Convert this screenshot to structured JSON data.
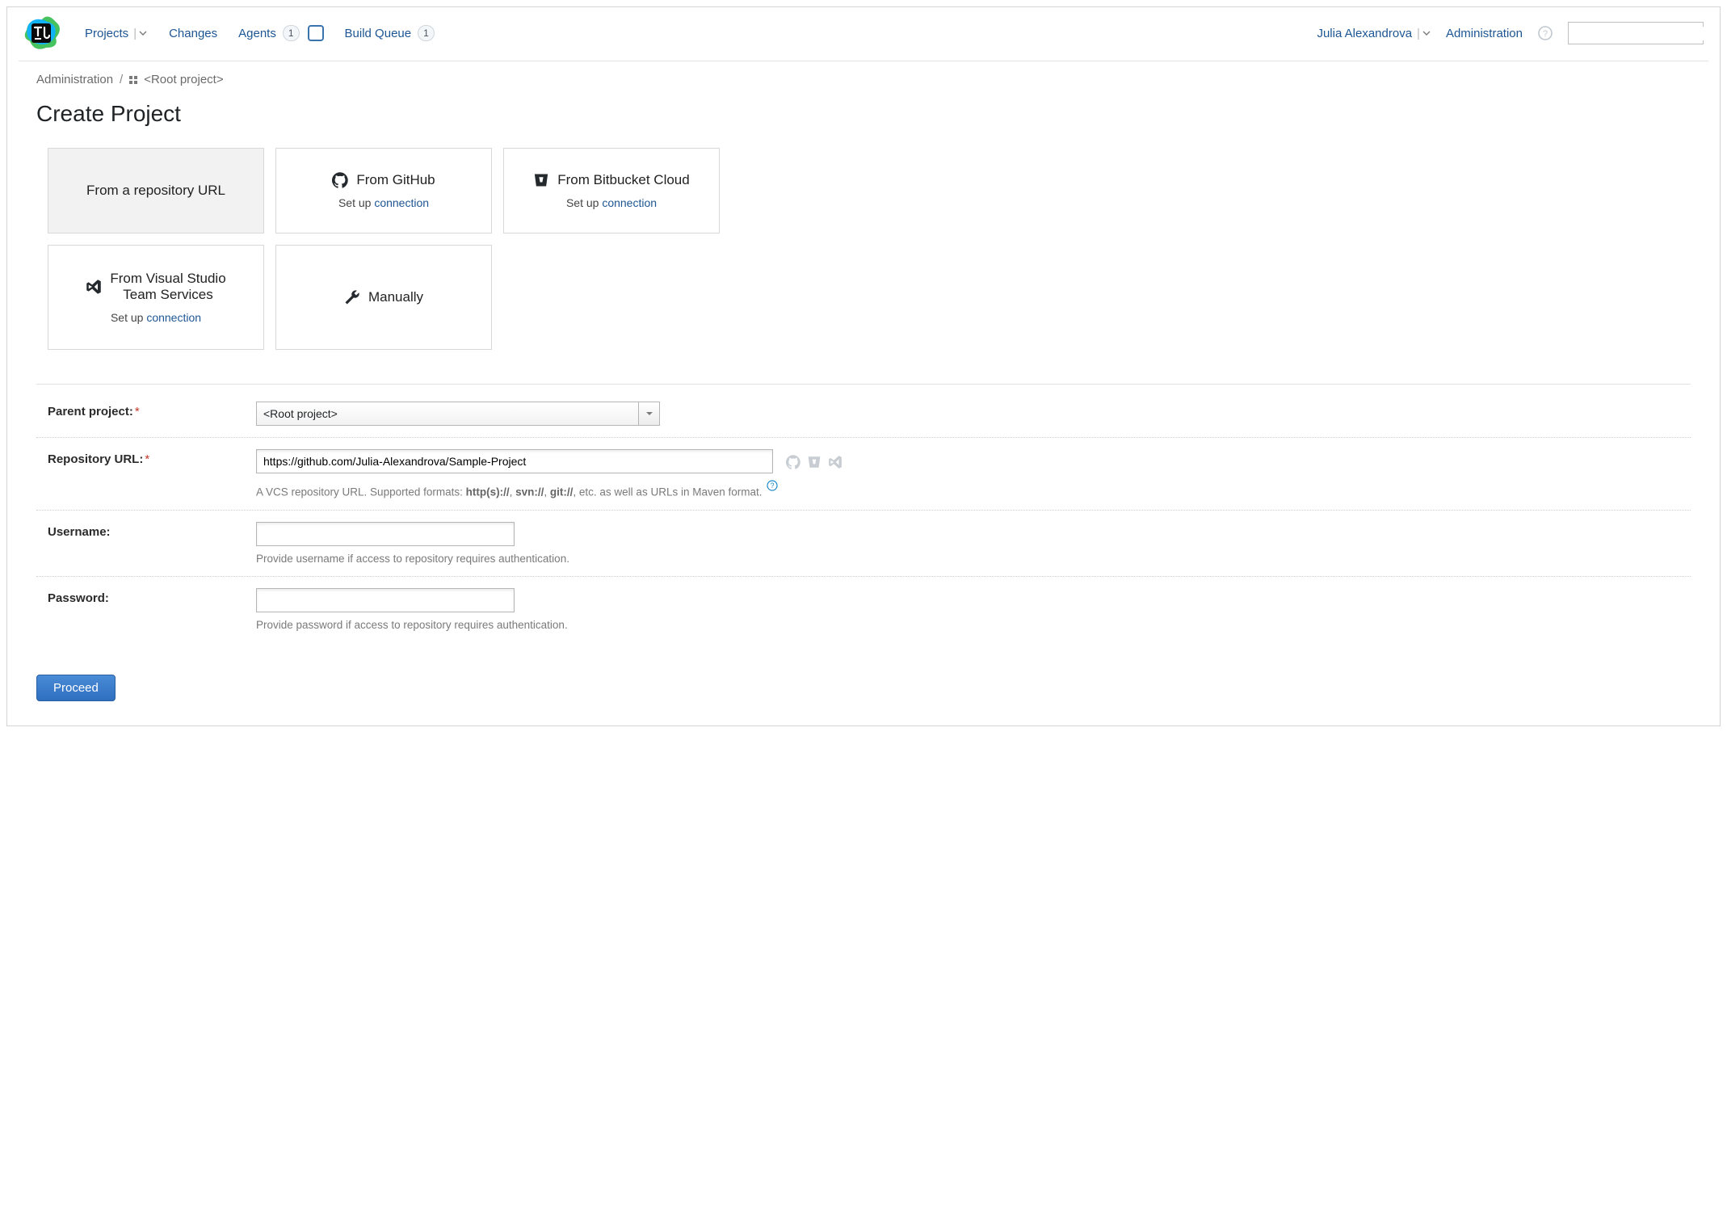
{
  "nav": {
    "projects": "Projects",
    "changes": "Changes",
    "agents": "Agents",
    "agents_count": "1",
    "build_queue": "Build Queue",
    "build_queue_count": "1",
    "user": "Julia Alexandrova",
    "administration": "Administration",
    "search_placeholder": ""
  },
  "breadcrumb": {
    "admin": "Administration",
    "root": "<Root project>"
  },
  "page_title": "Create Project",
  "cards": {
    "repo_url": "From a repository URL",
    "github": "From GitHub",
    "bitbucket": "From Bitbucket Cloud",
    "vsts_line1": "From Visual Studio",
    "vsts_line2": "Team Services",
    "manually": "Manually",
    "setup_prefix": "Set up ",
    "connection_link": "connection"
  },
  "form": {
    "parent_label": "Parent project:",
    "parent_value": "<Root project>",
    "repo_label": "Repository URL:",
    "repo_value": "https://github.com/Julia-Alexandrova/Sample-Project",
    "repo_hint_pre": "A VCS repository URL. Supported formats: ",
    "repo_hint_b1": "http(s)://",
    "repo_hint_sep": ", ",
    "repo_hint_b2": "svn://",
    "repo_hint_b3": "git://",
    "repo_hint_post": ", etc. as well as URLs in Maven format.",
    "username_label": "Username:",
    "username_hint": "Provide username if access to repository requires authentication.",
    "password_label": "Password:",
    "password_hint": "Provide password if access to repository requires authentication."
  },
  "actions": {
    "proceed": "Proceed"
  }
}
